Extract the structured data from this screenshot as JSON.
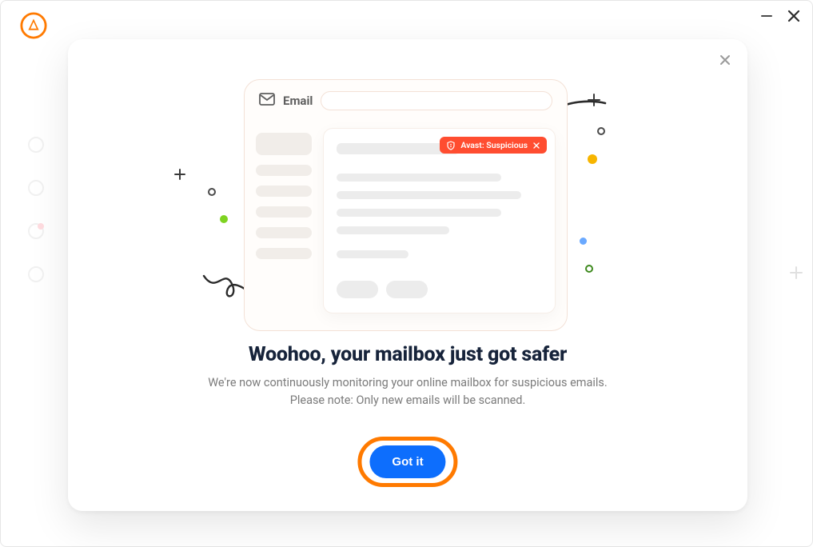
{
  "window": {
    "logo_color": "#ff7a00"
  },
  "modal": {
    "illustration": {
      "email_label": "Email",
      "suspicious_badge": "Avast: Suspicious"
    },
    "heading": "Woohoo, your mailbox just got safer",
    "body_line1": "We're now continuously monitoring your online mailbox for suspicious emails.",
    "body_line2": "Please note: Only new emails will be scanned.",
    "cta_label": "Got it"
  },
  "colors": {
    "accent_orange": "#ff7a00",
    "cta_blue": "#0d6efd",
    "danger_red": "#ff4d30"
  }
}
